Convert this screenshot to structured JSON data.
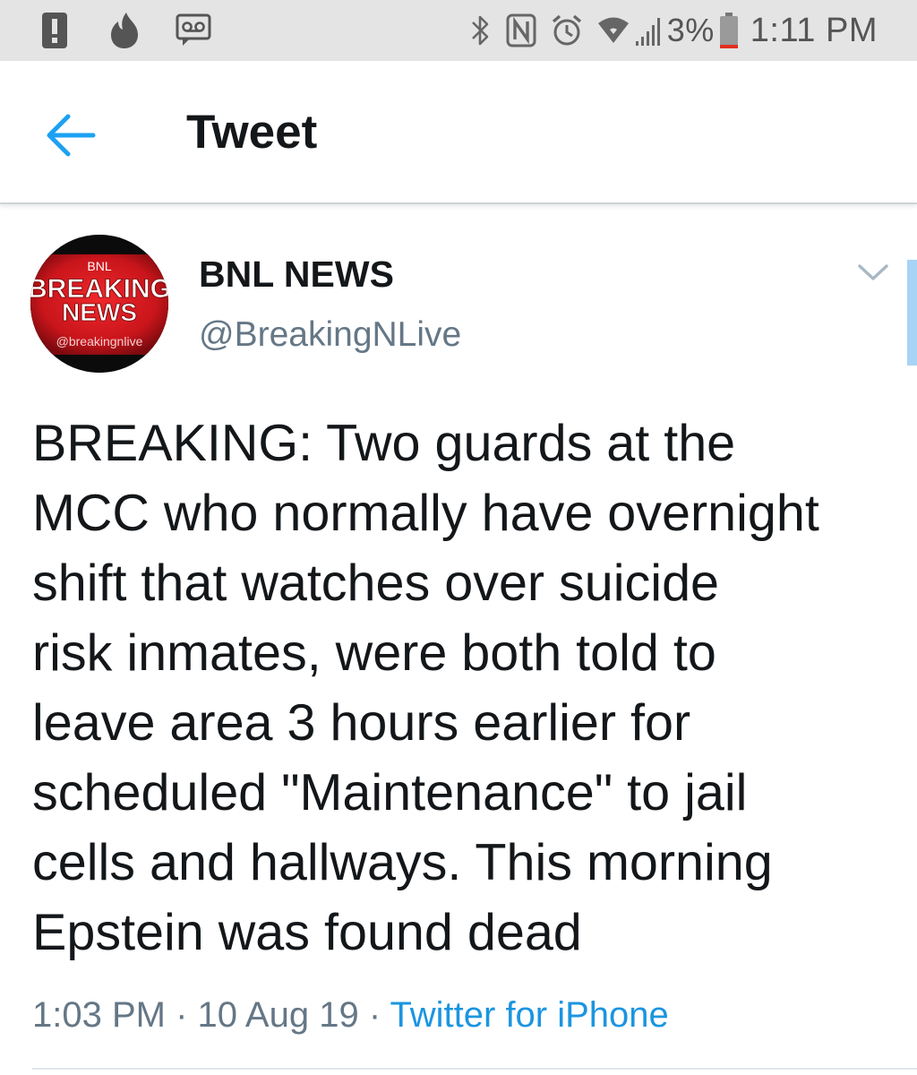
{
  "status_bar": {
    "left_icons": [
      "alert-icon",
      "tinder-flame-icon",
      "voicemail-icon"
    ],
    "right_icons": [
      "bluetooth-icon",
      "nfc-icon",
      "alarm-icon",
      "wifi-icon",
      "signal-icon",
      "battery-icon"
    ],
    "battery_percent": "3%",
    "time": "1:11 PM"
  },
  "app_bar": {
    "back_icon": "arrow-left-icon",
    "title": "Tweet"
  },
  "tweet": {
    "avatar": {
      "top_text": "BNL",
      "line1": "BREAKING",
      "line2": "NEWS",
      "handle_text": "@breakingnlive"
    },
    "display_name": "BNL NEWS",
    "handle": "@BreakingNLive",
    "more_icon": "chevron-down-icon",
    "text": "BREAKING: Two guards at the\nMCC who normally have overnight\nshift that watches over suicide\nrisk inmates, were both told to\nleave area 3 hours earlier for\nscheduled \"Maintenance\" to jail\ncells and hallways. This morning\nEpstein was found dead",
    "meta": {
      "time": "1:03 PM",
      "separator": " · ",
      "date": "10 Aug 19",
      "source": "Twitter for iPhone"
    }
  },
  "colors": {
    "status_bar_bg": "#e4e4e4",
    "accent": "#1da1f2",
    "link": "#1b95e0",
    "secondary_text": "#657786",
    "primary_text": "#14171a",
    "avatar_red": "#d7191f",
    "battery_low": "#e0301e"
  }
}
